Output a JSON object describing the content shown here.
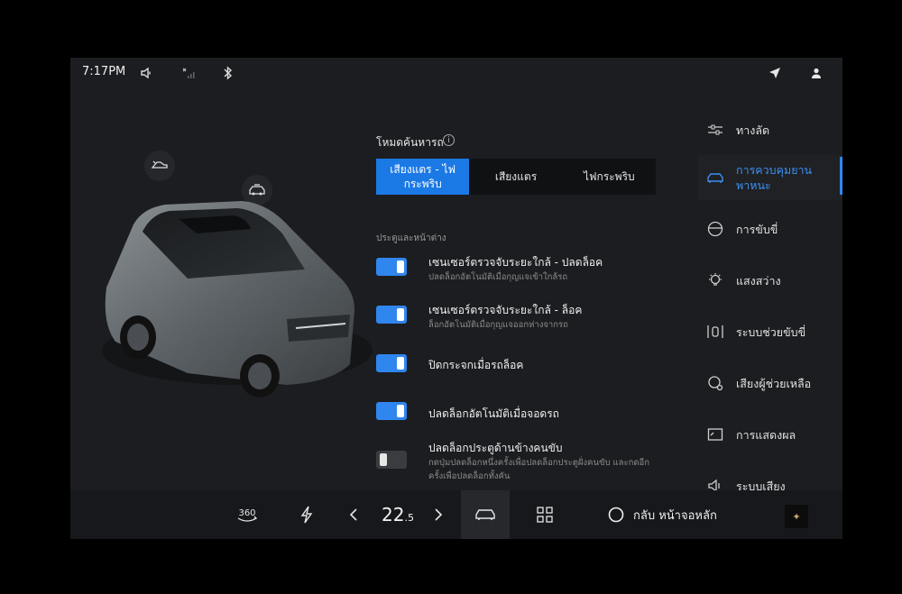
{
  "status": {
    "time": "7:17PM",
    "icons": [
      "volume-icon",
      "signal-icon",
      "bluetooth-icon",
      "location-icon",
      "user-icon"
    ]
  },
  "car_view": {
    "icons": [
      "door-open-icon",
      "car-roof-icon"
    ]
  },
  "driving_mode": {
    "title": "โหมดค้นหารถ",
    "info_symbol": "i",
    "options": [
      "เสียงแตร - ไฟกระพริบ",
      "เสียงแตร",
      "ไฟกระพริบ"
    ],
    "selected_index": 0
  },
  "doors_section": {
    "label": "ประตูและหน้าต่าง",
    "rows": [
      {
        "title": "เซนเซอร์ตรวจจับระยะใกล้ - ปลดล็อค",
        "subtitle": "ปลดล็อกอัตโนมัติเมื่อกุญแจเข้าใกล้รถ",
        "on": true
      },
      {
        "title": "เซนเซอร์ตรวจจับระยะใกล้ - ล็อค",
        "subtitle": "ล็อกอัตโนมัติเมื่อกุญแจออกห่างจากรถ",
        "on": true
      },
      {
        "title": "ปิดกระจกเมื่อรถล็อค",
        "subtitle": "",
        "on": true
      },
      {
        "title": "ปลดล็อกอัตโนมัติเมื่อจอดรถ",
        "subtitle": "",
        "on": true
      },
      {
        "title": "ปลดล็อกประตูด้านข้างคนขับ",
        "subtitle": "กดปุ่มปลดล็อกหนึ่งครั้งเพื่อปลดล็อกประตูฝั่งคนขับ และกดอีกครั้งเพื่อปลดล็อกทั้งคัน",
        "on": false
      }
    ]
  },
  "nav": {
    "items": [
      {
        "label": "ทางลัด",
        "icon": "sliders-icon"
      },
      {
        "label": "การควบคุมยานพาหนะ",
        "icon": "car-icon",
        "active": true
      },
      {
        "label": "การขับขี่",
        "icon": "steering-wheel-icon"
      },
      {
        "label": "แสงสว่าง",
        "icon": "light-bulb-icon"
      },
      {
        "label": "ระบบช่วยขับขี่",
        "icon": "driver-assist-icon"
      },
      {
        "label": "เสียงผู้ช่วยเหลือ",
        "icon": "voice-assistant-icon"
      },
      {
        "label": "การแสดงผล",
        "icon": "display-icon"
      },
      {
        "label": "ระบบเสียง",
        "icon": "speaker-icon"
      }
    ]
  },
  "dock": {
    "view_360": "360",
    "temperature_main": "22",
    "temperature_decimal": ".5",
    "home_label": "กลับ หน้าจอหลัก"
  },
  "colors": {
    "accent": "#2f86ee",
    "background": "#1c1d20"
  }
}
